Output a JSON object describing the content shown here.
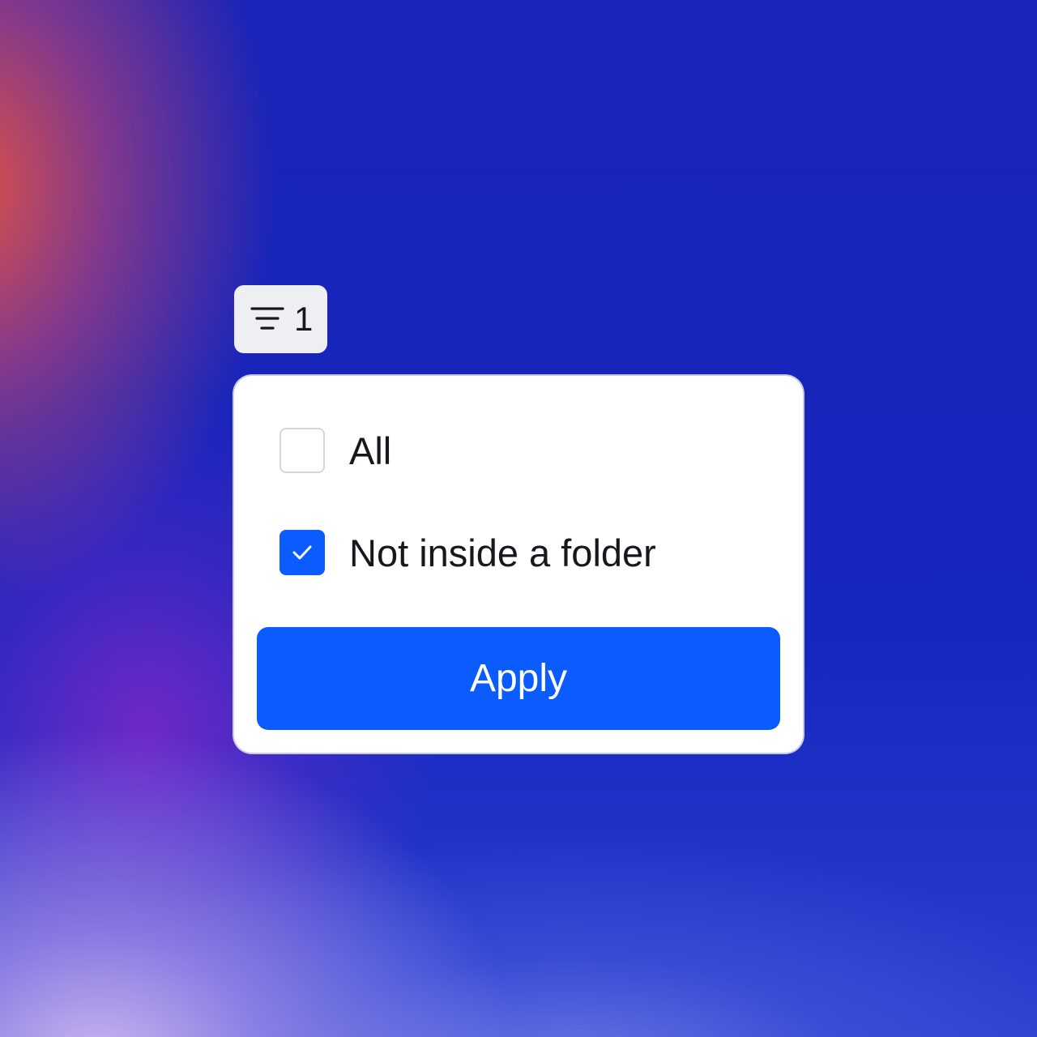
{
  "filter_chip": {
    "count": "1",
    "icon": "filter-icon"
  },
  "filter_panel": {
    "options": [
      {
        "label": "All",
        "checked": false
      },
      {
        "label": "Not inside a folder",
        "checked": true
      }
    ],
    "apply_label": "Apply"
  },
  "colors": {
    "accent": "#0a5cff",
    "text": "#16181d",
    "chip_background": "#eeeff2",
    "panel_background": "#ffffff",
    "checkbox_border": "#d5d7dd"
  }
}
